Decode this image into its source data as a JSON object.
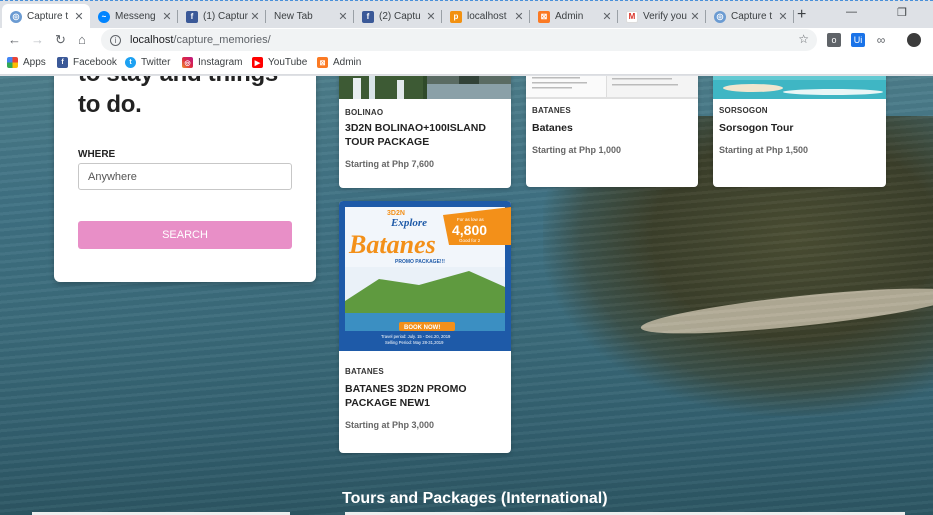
{
  "browser": {
    "tabs": [
      {
        "title": "Capture t",
        "favicon": "capture-icon",
        "color": "#6b9bd2",
        "active": true
      },
      {
        "title": "Messeng",
        "favicon": "messenger-icon",
        "color": "#0084ff"
      },
      {
        "title": "(1) Captur",
        "favicon": "facebook-icon",
        "color": "#3b5998"
      },
      {
        "title": "New Tab",
        "favicon": "",
        "color": ""
      },
      {
        "title": "(2) Captu",
        "favicon": "facebook-icon",
        "color": "#3b5998"
      },
      {
        "title": "localhost",
        "favicon": "pma-icon",
        "color": "#f29111"
      },
      {
        "title": "Admin",
        "favicon": "xampp-icon",
        "color": "#fb7a24"
      },
      {
        "title": "Verify you",
        "favicon": "gmail-icon",
        "color": "#d93025"
      },
      {
        "title": "Capture t",
        "favicon": "capture-icon",
        "color": "#6b9bd2"
      }
    ],
    "url_host": "localhost",
    "url_path": "/capture_memories/"
  },
  "bookmarks": [
    {
      "label": "Apps",
      "icon": "apps-grid-icon",
      "color": "#ea4335"
    },
    {
      "label": "Facebook",
      "icon": "facebook-icon",
      "color": "#3b5998"
    },
    {
      "label": "Twitter",
      "icon": "twitter-icon",
      "color": "#1da1f2"
    },
    {
      "label": "Instagram",
      "icon": "instagram-icon",
      "color": "#c13584"
    },
    {
      "label": "YouTube",
      "icon": "youtube-icon",
      "color": "#ff0000"
    },
    {
      "label": "Admin",
      "icon": "xampp-icon",
      "color": "#fb7a24"
    }
  ],
  "hero": {
    "line1": "to stay and things",
    "line2": "to do."
  },
  "search": {
    "where_label": "WHERE",
    "where_value": "Anywhere",
    "button_label": "SEARCH",
    "button_color": "#e88fc7"
  },
  "cards": [
    {
      "region": "BOLINAO",
      "title": "3D2N BOLINAO+100ISLAND TOUR PACKAGE",
      "price": "Starting at Php 7,600"
    },
    {
      "region": "BATANES",
      "title": "Batanes",
      "price": "Starting at Php 1,000"
    },
    {
      "region": "SORSOGON",
      "title": "Sorsogon Tour",
      "price": "Starting at Php 1,500"
    },
    {
      "region": "BATANES",
      "title": "BATANES 3D2N PROMO PACKAGE NEW1",
      "price": "Starting at Php 3,000"
    }
  ],
  "promo_image": {
    "tag": "3D2N",
    "headline": "Explore",
    "name": "Batanes",
    "subtitle": "PROMO PACKAGE!!!",
    "price_prefix": "For as low as",
    "price": "4,800",
    "price_suffix": "Good for 2",
    "cta": "BOOK NOW!",
    "travel_period": "Travel period: July. 15 - Dec.20, 2019",
    "selling_period": "Selling Period: May 28-31,2019"
  },
  "section_title": "Tours and Packages (International)"
}
